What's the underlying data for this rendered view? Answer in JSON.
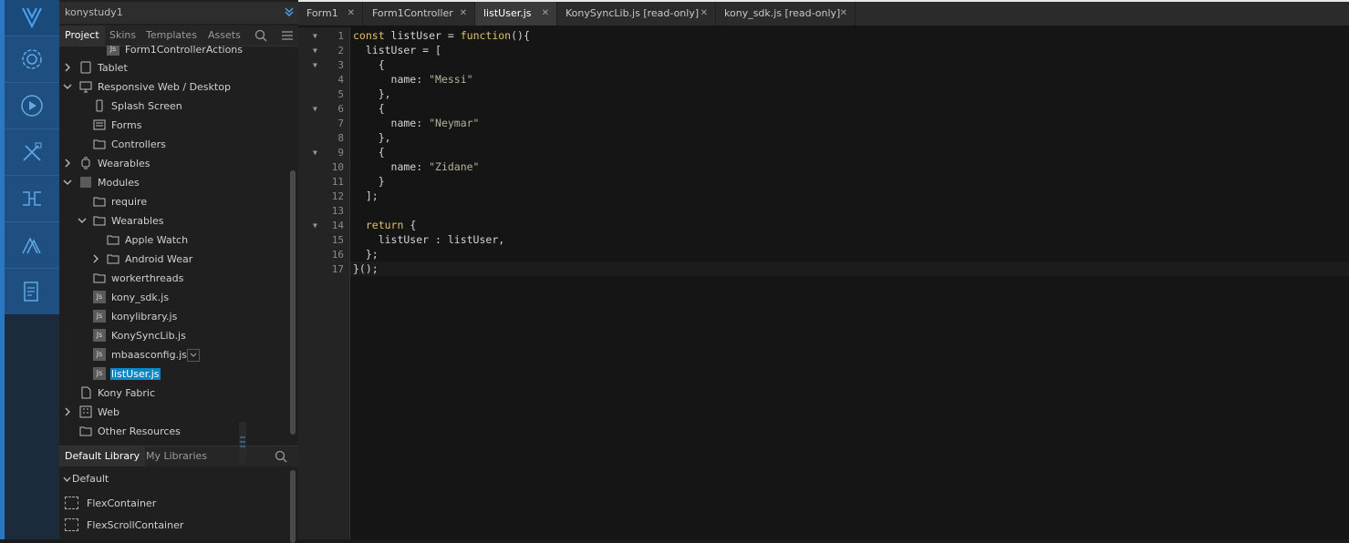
{
  "app": {
    "project_name": "konystudy1",
    "brand_color": "#1e4f80",
    "accent": "#0c88c7"
  },
  "rail": {
    "icons": [
      "logo-icon",
      "settings-icon",
      "run-icon",
      "build-icon",
      "align-icon",
      "fabric-icon",
      "document-icon"
    ]
  },
  "project_panel": {
    "tabs": [
      "Project",
      "Skins",
      "Templates",
      "Assets"
    ],
    "active_tab": "Project",
    "tree": [
      {
        "label": "Form1ControllerActions"
      },
      {
        "label": "Tablet"
      },
      {
        "label": "Responsive Web / Desktop"
      },
      {
        "label": "Splash Screen"
      },
      {
        "label": "Forms"
      },
      {
        "label": "Controllers"
      },
      {
        "label": "Wearables"
      },
      {
        "label": "Modules"
      },
      {
        "label": "require"
      },
      {
        "label": "Wearables"
      },
      {
        "label": "Apple Watch"
      },
      {
        "label": "Android Wear"
      },
      {
        "label": "workerthreads"
      },
      {
        "label": "kony_sdk.js"
      },
      {
        "label": "konylibrary.js"
      },
      {
        "label": "KonySyncLib.js"
      },
      {
        "label": "mbaasconfig.js"
      },
      {
        "label": "listUser.js"
      },
      {
        "label": "Kony Fabric"
      },
      {
        "label": "Web"
      },
      {
        "label": "Other Resources"
      }
    ],
    "js_badge": "Js"
  },
  "library": {
    "tabs": [
      "Default Library",
      "My Libraries"
    ],
    "section": "Default",
    "items": [
      "FlexContainer",
      "FlexScrollContainer"
    ]
  },
  "editor": {
    "tabs": [
      {
        "label": "Form1"
      },
      {
        "label": "Form1Controller"
      },
      {
        "label": "listUser.js"
      },
      {
        "label": "KonySyncLib.js [read-only]"
      },
      {
        "label": "kony_sdk.js [read-only]"
      }
    ],
    "active_tab": "listUser.js",
    "line_numbers": [
      "1",
      "2",
      "3",
      "4",
      "5",
      "6",
      "7",
      "8",
      "9",
      "10",
      "11",
      "12",
      "13",
      "14",
      "15",
      "16",
      "17"
    ],
    "code": {
      "l1_kw": "const",
      "l1_rest": " listUser = ",
      "l1_kw2": "function",
      "l1_end": "(){",
      "l2": "  listUser = [",
      "l3": "    {",
      "l4_key": "      name: ",
      "l4_val": "\"Messi\"",
      "l5": "    },",
      "l6": "    {",
      "l7_key": "      name: ",
      "l7_val": "\"Neymar\"",
      "l8": "    },",
      "l9": "    {",
      "l10_key": "      name: ",
      "l10_val": "\"Zidane\"",
      "l11": "    }",
      "l12": "  ];",
      "l13": "",
      "l14_kw": "  return",
      "l14_rest": " {",
      "l15": "    listUser : listUser,",
      "l16": "  };",
      "l17": "}();"
    }
  }
}
